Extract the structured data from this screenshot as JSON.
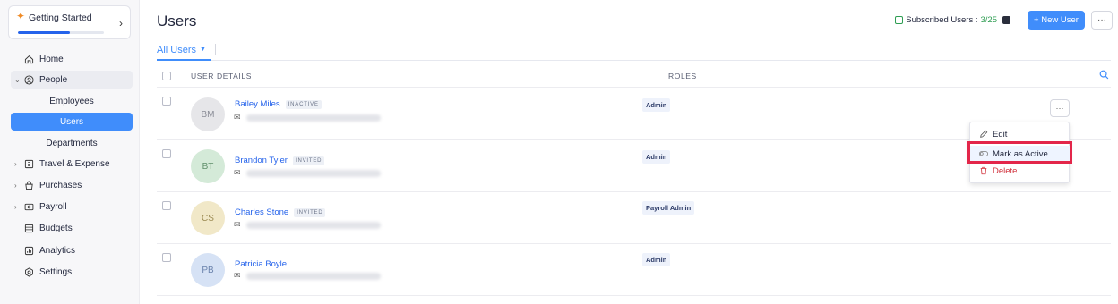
{
  "sidebar": {
    "getting_started": {
      "title": "Getting Started",
      "progress": 0.6
    },
    "items": [
      {
        "label": "Home",
        "icon": "home-icon"
      },
      {
        "label": "People",
        "icon": "people-icon"
      },
      {
        "label": "Employees"
      },
      {
        "label": "Users"
      },
      {
        "label": "Departments"
      },
      {
        "label": "Travel & Expense",
        "icon": "travel-icon"
      },
      {
        "label": "Purchases",
        "icon": "purchases-icon"
      },
      {
        "label": "Payroll",
        "icon": "payroll-icon"
      },
      {
        "label": "Budgets",
        "icon": "budgets-icon"
      },
      {
        "label": "Analytics",
        "icon": "analytics-icon"
      },
      {
        "label": "Settings",
        "icon": "settings-icon"
      }
    ]
  },
  "header": {
    "title": "Users",
    "subscribed_label": "Subscribed Users : ",
    "subscribed_count": "3/25",
    "new_user_label": "+ New User",
    "more_label": "···"
  },
  "view": {
    "label": "All Users"
  },
  "table": {
    "columns": {
      "user_details": "USER DETAILS",
      "roles": "ROLES"
    },
    "rows": [
      {
        "initials": "BM",
        "name": "Bailey Miles",
        "status": "INACTIVE",
        "role": "Admin",
        "avatar_bg": "#e6e6e9",
        "avatar_fg": "#8a8c96"
      },
      {
        "initials": "BT",
        "name": "Brandon Tyler",
        "status": "INVITED",
        "role": "Admin",
        "avatar_bg": "#d4ead8",
        "avatar_fg": "#5f8f6a"
      },
      {
        "initials": "CS",
        "name": "Charles Stone",
        "status": "INVITED",
        "role": "Payroll Admin",
        "avatar_bg": "#f1e8c8",
        "avatar_fg": "#9b8a52"
      },
      {
        "initials": "PB",
        "name": "Patricia Boyle",
        "status": "",
        "role": "Admin",
        "avatar_bg": "#d6e2f5",
        "avatar_fg": "#6b83ad"
      }
    ]
  },
  "row_menu": {
    "edit": "Edit",
    "mark_active": "Mark as Active",
    "delete": "Delete"
  },
  "colors": {
    "accent": "#408dfb",
    "highlight": "#e3264a",
    "danger": "#d0303b",
    "success": "#2e9d52"
  }
}
